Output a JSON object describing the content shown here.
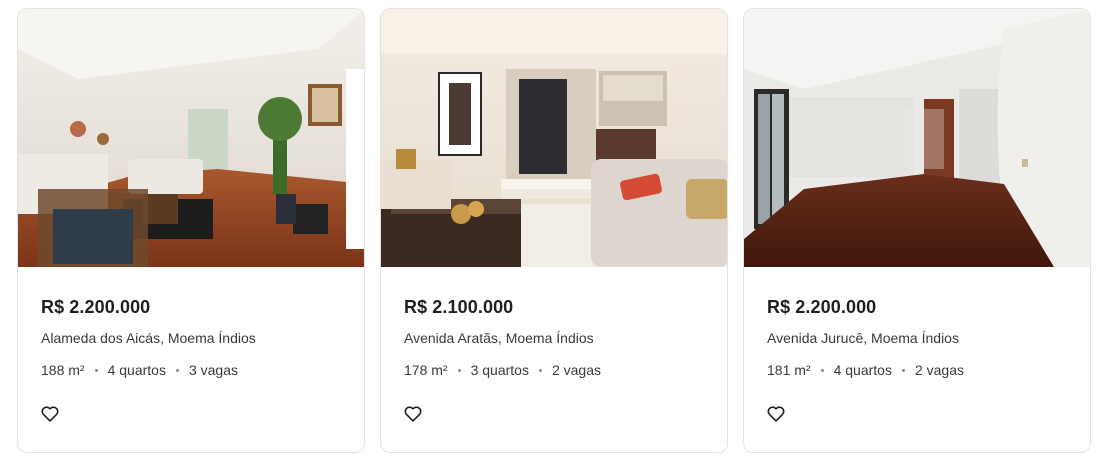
{
  "listings": [
    {
      "price": "R$ 2.200.000",
      "address": "Alameda dos Aicás, Moema Índios",
      "area": "188 m²",
      "bedrooms": "4 quartos",
      "parking": "3 vagas",
      "favorite_icon": "heart-outline-icon"
    },
    {
      "price": "R$ 2.100.000",
      "address": "Avenida Aratãs, Moema Índios",
      "area": "178 m²",
      "bedrooms": "3 quartos",
      "parking": "2 vagas",
      "favorite_icon": "heart-outline-icon"
    },
    {
      "price": "R$ 2.200.000",
      "address": "Avenida Jurucê, Moema Índios",
      "area": "181 m²",
      "bedrooms": "4 quartos",
      "parking": "2 vagas",
      "favorite_icon": "heart-outline-icon"
    }
  ]
}
